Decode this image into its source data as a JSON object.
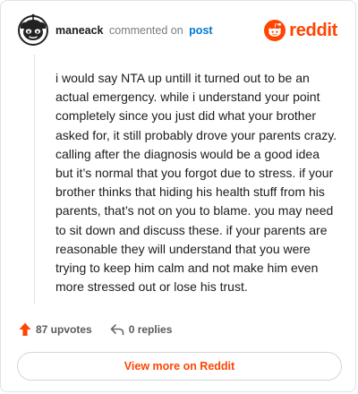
{
  "header": {
    "username": "maneack",
    "action_text": "commented on",
    "post_link": "post",
    "brand": "reddit"
  },
  "comment": {
    "body": "i would say NTA up untill it turned out to be an actual emergency. while i understand your point completely since you just did what your brother asked for, it still probably drove your parents crazy. calling after the diagnosis would be a good idea but it’s normal that you forgot due to stress. if your brother thinks that hiding his health stuff from his parents, that’s not on you to blame. you may need to sit down and discuss these. if your parents are reasonable they will understand that you were trying to keep him calm and not make him even more stressed out or lose his trust."
  },
  "footer": {
    "upvotes": "87 upvotes",
    "replies": "0 replies"
  },
  "cta": {
    "label": "View more on Reddit"
  },
  "colors": {
    "brand_orange": "#ff4500",
    "link_blue": "#0079d3",
    "muted_text": "#7c7c7c"
  },
  "icons": {
    "avatar": "snoo-avatar-icon",
    "brand": "reddit-logo-icon",
    "upvote": "upvote-arrow-icon",
    "reply": "reply-arrow-icon"
  }
}
